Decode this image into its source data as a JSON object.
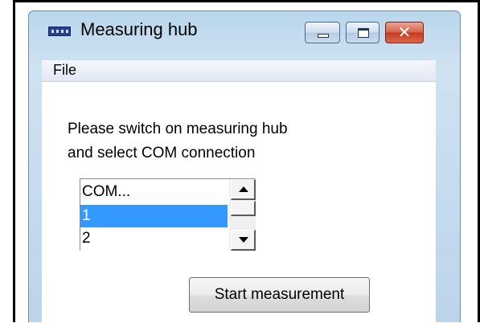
{
  "window": {
    "title": "Measuring hub",
    "icon": "app-icon",
    "caption_buttons": {
      "minimize": "minimize-icon",
      "maximize": "maximize-icon",
      "close": "close-icon"
    }
  },
  "menu": {
    "items": [
      {
        "label": "File"
      }
    ]
  },
  "main": {
    "message_line1": "Please switch on measuring hub",
    "message_line2": "and select COM connection",
    "com_list": {
      "items": [
        {
          "label": "COM..."
        },
        {
          "label": "1"
        },
        {
          "label": "2"
        }
      ],
      "selected": "1"
    },
    "start_button": "Start measurement"
  },
  "colors": {
    "selection": "#3399ff",
    "close_button": "#c23a20"
  }
}
